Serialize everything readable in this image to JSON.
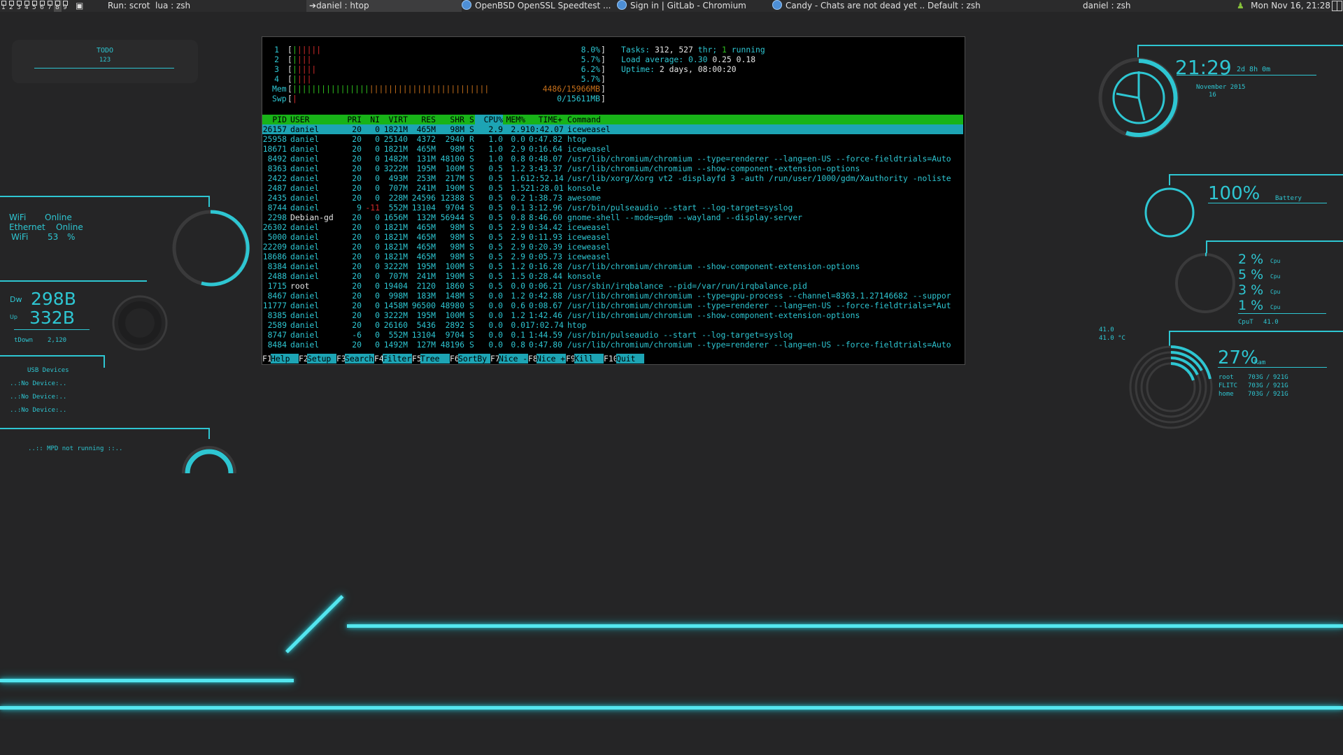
{
  "topbar": {
    "tags": [
      "1",
      "2",
      "3",
      "4",
      "5",
      "6",
      "7",
      "8",
      "9"
    ],
    "active_tag": "8",
    "run_prompt": "Run: scrot",
    "tasks": [
      {
        "label": "lua : zsh",
        "icon": "none"
      },
      {
        "label": "daniel : htop",
        "icon": "terminal-arrow",
        "focused": true
      },
      {
        "label": "OpenBSD OpenSSL Speedtest ...",
        "icon": "chromium"
      },
      {
        "label": "Sign in | GitLab - Chromium",
        "icon": "chromium"
      },
      {
        "label": "Candy - Chats are not dead yet ...",
        "icon": "chromium"
      },
      {
        "label": "Default : zsh",
        "icon": "none"
      },
      {
        "label": "daniel : zsh",
        "icon": "none"
      }
    ],
    "clock": "Mon Nov 16, 21:28"
  },
  "todo": {
    "title": "TODO",
    "subtitle": "123"
  },
  "network": {
    "wifi_label": "WiFi",
    "wifi_status": "Online",
    "ethernet_label": "Ethernet",
    "ethernet_status": "Online",
    "wifi_signal_label": "WiFi",
    "wifi_signal_value": "53",
    "wifi_signal_unit": "%",
    "down_label": "Dw",
    "down_value": "298B",
    "up_label": "Up",
    "up_value": "332B",
    "total_down_label": "tDown",
    "total_down_value": "2,120"
  },
  "usb": {
    "title": "USB Devices",
    "devices": [
      "..:No Device:..",
      "..:No Device:..",
      "..:No Device:.."
    ]
  },
  "mpd": {
    "status": "..:: MPD not running ::.."
  },
  "clock_widget": {
    "time": "21:29",
    "uptime": "2d 8h 0m",
    "month_year": "November 2015",
    "day": "16"
  },
  "battery": {
    "value": "100%",
    "label": "Battery",
    "fraction": 1.0
  },
  "cpu_widget": {
    "cores": [
      {
        "value": "2 %",
        "label": "Cpu"
      },
      {
        "value": "5 %",
        "label": "Cpu"
      },
      {
        "value": "3 %",
        "label": "Cpu"
      },
      {
        "value": "1 %",
        "label": "Cpu"
      }
    ],
    "temp_label": "CpuT",
    "temp_value": "41.0",
    "temp_side_1": "41.0",
    "temp_side_2": "41.0 °C"
  },
  "ram_widget": {
    "value": "27%",
    "label": "Ram",
    "fraction": 0.27,
    "disks": [
      {
        "name": "root",
        "used": "703G",
        "sep": "/",
        "total": "921G"
      },
      {
        "name": "FLITC",
        "used": "703G",
        "sep": "/",
        "total": "921G"
      },
      {
        "name": "home",
        "used": "703G",
        "sep": "/",
        "total": "921G"
      }
    ]
  },
  "htop": {
    "cpus": [
      {
        "num": "1",
        "pct": "8.0%",
        "g": 1,
        "r": 5
      },
      {
        "num": "2",
        "pct": "5.7%",
        "g": 1,
        "r": 3
      },
      {
        "num": "3",
        "pct": "6.2%",
        "g": 1,
        "r": 4
      },
      {
        "num": "4",
        "pct": "5.7%",
        "g": 1,
        "r": 3
      }
    ],
    "mem_label": "Mem",
    "mem_value": "4486/15966MB",
    "swp_label": "Swp",
    "swp_value": "0/15611MB",
    "tasks_label": "Tasks:",
    "tasks_value": "312,",
    "threads_value": "527",
    "threads_label": "thr;",
    "running_value": "1",
    "running_label": "running",
    "load_label": "Load average:",
    "load1": "0.30",
    "load5": "0.25",
    "load15": "0.18",
    "uptime_label": "Uptime:",
    "uptime_value": "2 days, 08:00:20",
    "columns": [
      "PID",
      "USER",
      "PRI",
      "NI",
      "VIRT",
      "RES",
      "SHR",
      "S",
      "CPU%",
      "MEM%",
      "TIME+",
      "Command"
    ],
    "processes": [
      [
        "26157",
        "daniel",
        "20",
        "0",
        "1821M",
        "465M",
        "98M",
        "S",
        "2.9",
        "2.9",
        "10:42.07",
        "iceweasel"
      ],
      [
        "25958",
        "daniel",
        "20",
        "0",
        "25140",
        "4372",
        "2940",
        "R",
        "1.0",
        "0.0",
        "0:47.82",
        "htop"
      ],
      [
        "18671",
        "daniel",
        "20",
        "0",
        "1821M",
        "465M",
        "98M",
        "S",
        "1.0",
        "2.9",
        "0:16.64",
        "iceweasel"
      ],
      [
        "8492",
        "daniel",
        "20",
        "0",
        "1482M",
        "131M",
        "48100",
        "S",
        "1.0",
        "0.8",
        "0:48.07",
        "/usr/lib/chromium/chromium --type=renderer --lang=en-US --force-fieldtrials=Auto"
      ],
      [
        "8363",
        "daniel",
        "20",
        "0",
        "3222M",
        "195M",
        "100M",
        "S",
        "0.5",
        "1.2",
        "3:43.37",
        "/usr/lib/chromium/chromium --show-component-extension-options"
      ],
      [
        "2422",
        "daniel",
        "20",
        "0",
        "493M",
        "253M",
        "217M",
        "S",
        "0.5",
        "1.6",
        "12:52.14",
        "/usr/lib/xorg/Xorg vt2 -displayfd 3 -auth /run/user/1000/gdm/Xauthority -noliste"
      ],
      [
        "2487",
        "daniel",
        "20",
        "0",
        "707M",
        "241M",
        "190M",
        "S",
        "0.5",
        "1.5",
        "21:28.01",
        "konsole"
      ],
      [
        "2435",
        "daniel",
        "20",
        "0",
        "228M",
        "24596",
        "12388",
        "S",
        "0.5",
        "0.2",
        "1:38.73",
        "awesome"
      ],
      [
        "8744",
        "daniel",
        "9",
        "-11",
        "552M",
        "13104",
        "9704",
        "S",
        "0.5",
        "0.1",
        "3:12.96",
        "/usr/bin/pulseaudio --start --log-target=syslog"
      ],
      [
        "2298",
        "Debian-gd",
        "20",
        "0",
        "1656M",
        "132M",
        "56944",
        "S",
        "0.5",
        "0.8",
        "8:46.60",
        "gnome-shell --mode=gdm --wayland --display-server"
      ],
      [
        "26302",
        "daniel",
        "20",
        "0",
        "1821M",
        "465M",
        "98M",
        "S",
        "0.5",
        "2.9",
        "0:34.42",
        "iceweasel"
      ],
      [
        "5000",
        "daniel",
        "20",
        "0",
        "1821M",
        "465M",
        "98M",
        "S",
        "0.5",
        "2.9",
        "0:11.93",
        "iceweasel"
      ],
      [
        "22209",
        "daniel",
        "20",
        "0",
        "1821M",
        "465M",
        "98M",
        "S",
        "0.5",
        "2.9",
        "0:20.39",
        "iceweasel"
      ],
      [
        "18686",
        "daniel",
        "20",
        "0",
        "1821M",
        "465M",
        "98M",
        "S",
        "0.5",
        "2.9",
        "0:05.73",
        "iceweasel"
      ],
      [
        "8384",
        "daniel",
        "20",
        "0",
        "3222M",
        "195M",
        "100M",
        "S",
        "0.5",
        "1.2",
        "0:16.28",
        "/usr/lib/chromium/chromium --show-component-extension-options"
      ],
      [
        "2488",
        "daniel",
        "20",
        "0",
        "707M",
        "241M",
        "190M",
        "S",
        "0.5",
        "1.5",
        "0:28.44",
        "konsole"
      ],
      [
        "1715",
        "root",
        "20",
        "0",
        "19404",
        "2120",
        "1860",
        "S",
        "0.5",
        "0.0",
        "0:06.21",
        "/usr/sbin/irqbalance --pid=/var/run/irqbalance.pid"
      ],
      [
        "8467",
        "daniel",
        "20",
        "0",
        "998M",
        "183M",
        "148M",
        "S",
        "0.0",
        "1.2",
        "0:42.88",
        "/usr/lib/chromium/chromium --type=gpu-process --channel=8363.1.27146682 --suppor"
      ],
      [
        "11777",
        "daniel",
        "20",
        "0",
        "1458M",
        "96500",
        "48980",
        "S",
        "0.0",
        "0.6",
        "0:08.67",
        "/usr/lib/chromium/chromium --type=renderer --lang=en-US --force-fieldtrials=*Aut"
      ],
      [
        "8385",
        "daniel",
        "20",
        "0",
        "3222M",
        "195M",
        "100M",
        "S",
        "0.0",
        "1.2",
        "1:42.46",
        "/usr/lib/chromium/chromium --show-component-extension-options"
      ],
      [
        "2589",
        "daniel",
        "20",
        "0",
        "26160",
        "5436",
        "2892",
        "S",
        "0.0",
        "0.0",
        "17:02.74",
        "htop"
      ],
      [
        "8747",
        "daniel",
        "-6",
        "0",
        "552M",
        "13104",
        "9704",
        "S",
        "0.0",
        "0.1",
        "1:44.59",
        "/usr/bin/pulseaudio --start --log-target=syslog"
      ],
      [
        "8484",
        "daniel",
        "20",
        "0",
        "1492M",
        "127M",
        "48196",
        "S",
        "0.0",
        "0.8",
        "0:47.80",
        "/usr/lib/chromium/chromium --type=renderer --lang=en-US --force-fieldtrials=Auto"
      ]
    ],
    "fkeys": [
      {
        "key": "F1",
        "label": "Help"
      },
      {
        "key": "F2",
        "label": "Setup"
      },
      {
        "key": "F3",
        "label": "Search"
      },
      {
        "key": "F4",
        "label": "Filter"
      },
      {
        "key": "F5",
        "label": "Tree"
      },
      {
        "key": "F6",
        "label": "SortBy"
      },
      {
        "key": "F7",
        "label": "Nice -"
      },
      {
        "key": "F8",
        "label": "Nice +"
      },
      {
        "key": "F9",
        "label": "Kill"
      },
      {
        "key": "F10",
        "label": "Quit"
      }
    ]
  },
  "colors": {
    "accent": "#2ec6d2",
    "background": "#252526",
    "htop_header": "#18b318",
    "htop_selected": "#1da4b4",
    "neon": "#54e6ef"
  }
}
